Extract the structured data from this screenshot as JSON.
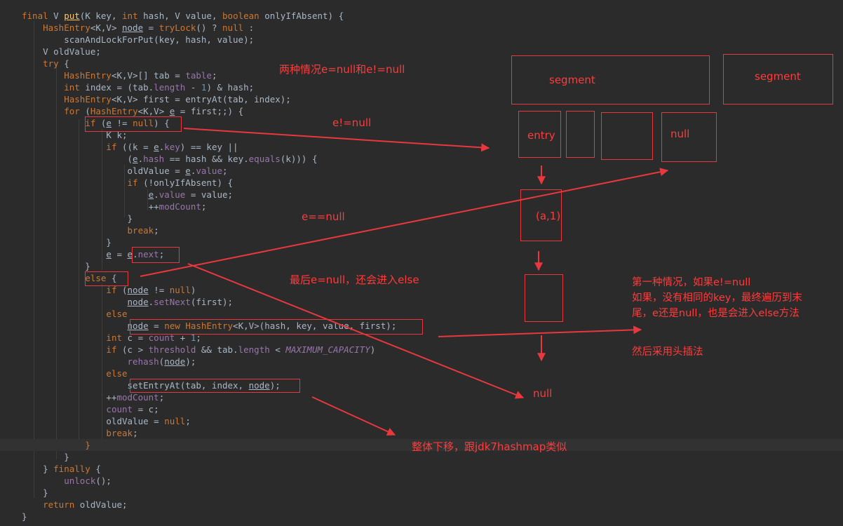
{
  "code": {
    "lines": [
      [
        {
          "t": "final ",
          "c": "kw"
        },
        {
          "t": "V "
        },
        {
          "t": "put",
          "c": "fn u"
        },
        {
          "t": "(K key, "
        },
        {
          "t": "int ",
          "c": "kw"
        },
        {
          "t": "hash, V value, "
        },
        {
          "t": "boolean ",
          "c": "kw"
        },
        {
          "t": "onlyIfAbsent) {"
        }
      ],
      [
        {
          "t": "    "
        },
        {
          "t": "HashEntry",
          "c": "kw"
        },
        {
          "t": "<K,V> "
        },
        {
          "t": "node",
          "c": "u"
        },
        {
          "t": " = "
        },
        {
          "t": "tryLock",
          "c": "kw"
        },
        {
          "t": "() ? "
        },
        {
          "t": "null",
          "c": "kw"
        },
        {
          "t": " :"
        }
      ],
      [
        {
          "t": "        scanAndLockForPut(key, hash, value);"
        }
      ],
      [
        {
          "t": "    V oldValue;"
        }
      ],
      [
        {
          "t": "    "
        },
        {
          "t": "try",
          "c": "kw"
        },
        {
          "t": " {"
        }
      ],
      [
        {
          "t": "        "
        },
        {
          "t": "HashEntry",
          "c": "kw"
        },
        {
          "t": "<K,V>[] tab = "
        },
        {
          "t": "table",
          "c": "fld"
        },
        {
          "t": ";"
        }
      ],
      [
        {
          "t": "        "
        },
        {
          "t": "int ",
          "c": "kw"
        },
        {
          "t": "index = (tab."
        },
        {
          "t": "length",
          "c": "fld"
        },
        {
          "t": " - "
        },
        {
          "t": "1",
          "c": "num"
        },
        {
          "t": ") & hash;"
        }
      ],
      [
        {
          "t": "        "
        },
        {
          "t": "HashEntry",
          "c": "kw"
        },
        {
          "t": "<K,V> first = entryAt(tab, index);"
        }
      ],
      [
        {
          "t": "        "
        },
        {
          "t": "for ",
          "c": "kw"
        },
        {
          "t": "("
        },
        {
          "t": "HashEntry",
          "c": "kw"
        },
        {
          "t": "<K,V> "
        },
        {
          "t": "e",
          "c": "u"
        },
        {
          "t": " = first;;) {"
        }
      ],
      [
        {
          "t": "            "
        },
        {
          "t": "if ",
          "c": "kw"
        },
        {
          "t": "("
        },
        {
          "t": "e",
          "c": "u"
        },
        {
          "t": " != "
        },
        {
          "t": "null",
          "c": "kw"
        },
        {
          "t": ") {"
        }
      ],
      [
        {
          "t": "                K k;"
        }
      ],
      [
        {
          "t": "                "
        },
        {
          "t": "if ",
          "c": "kw"
        },
        {
          "t": "((k = "
        },
        {
          "t": "e",
          "c": "u"
        },
        {
          "t": "."
        },
        {
          "t": "key",
          "c": "fld"
        },
        {
          "t": ") == key ||"
        }
      ],
      [
        {
          "t": "                    ("
        },
        {
          "t": "e",
          "c": "u"
        },
        {
          "t": "."
        },
        {
          "t": "hash",
          "c": "fld"
        },
        {
          "t": " == hash && key."
        },
        {
          "t": "equals",
          "c": "fld"
        },
        {
          "t": "(k))) {"
        }
      ],
      [
        {
          "t": "                    oldValue = "
        },
        {
          "t": "e",
          "c": "u"
        },
        {
          "t": "."
        },
        {
          "t": "value",
          "c": "fld"
        },
        {
          "t": ";"
        }
      ],
      [
        {
          "t": "                    "
        },
        {
          "t": "if ",
          "c": "kw"
        },
        {
          "t": "(!onlyIfAbsent) {"
        }
      ],
      [
        {
          "t": "                        "
        },
        {
          "t": "e",
          "c": "u"
        },
        {
          "t": "."
        },
        {
          "t": "value",
          "c": "fld"
        },
        {
          "t": " = value;"
        }
      ],
      [
        {
          "t": "                        ++"
        },
        {
          "t": "modCount",
          "c": "fld"
        },
        {
          "t": ";"
        }
      ],
      [
        {
          "t": "                    }"
        }
      ],
      [
        {
          "t": "                    "
        },
        {
          "t": "break",
          "c": "kw"
        },
        {
          "t": ";"
        }
      ],
      [
        {
          "t": "                }"
        }
      ],
      [
        {
          "t": "                "
        },
        {
          "t": "e",
          "c": "u"
        },
        {
          "t": " = "
        },
        {
          "t": "e",
          "c": "u"
        },
        {
          "t": "."
        },
        {
          "t": "next",
          "c": "fld"
        },
        {
          "t": ";"
        }
      ],
      [
        {
          "t": "            }"
        }
      ],
      [
        {
          "t": "            "
        },
        {
          "t": "else",
          "c": "kw"
        },
        {
          "t": " {"
        }
      ],
      [
        {
          "t": "                "
        },
        {
          "t": "if ",
          "c": "kw"
        },
        {
          "t": "("
        },
        {
          "t": "node",
          "c": "u"
        },
        {
          "t": " != "
        },
        {
          "t": "null",
          "c": "kw"
        },
        {
          "t": ")"
        }
      ],
      [
        {
          "t": "                    "
        },
        {
          "t": "node",
          "c": "u"
        },
        {
          "t": "."
        },
        {
          "t": "setNext",
          "c": "fld"
        },
        {
          "t": "(first);"
        }
      ],
      [
        {
          "t": "                "
        },
        {
          "t": "else",
          "c": "kw"
        }
      ],
      [
        {
          "t": "                    "
        },
        {
          "t": "node",
          "c": "u"
        },
        {
          "t": " = "
        },
        {
          "t": "new ",
          "c": "kw"
        },
        {
          "t": "HashEntry",
          "c": "kw"
        },
        {
          "t": "<K,V>(hash, key, value, first);"
        }
      ],
      [
        {
          "t": "                "
        },
        {
          "t": "int ",
          "c": "kw"
        },
        {
          "t": "c = "
        },
        {
          "t": "count",
          "c": "fld"
        },
        {
          "t": " + "
        },
        {
          "t": "1",
          "c": "num"
        },
        {
          "t": ";"
        }
      ],
      [
        {
          "t": "                "
        },
        {
          "t": "if ",
          "c": "kw"
        },
        {
          "t": "(c > "
        },
        {
          "t": "threshold",
          "c": "fld"
        },
        {
          "t": " && tab."
        },
        {
          "t": "length",
          "c": "fld"
        },
        {
          "t": " < "
        },
        {
          "t": "MAXIMUM_CAPACITY",
          "c": "const"
        },
        {
          "t": ")"
        }
      ],
      [
        {
          "t": "                    "
        },
        {
          "t": "rehash",
          "c": "fld"
        },
        {
          "t": "("
        },
        {
          "t": "node",
          "c": "u"
        },
        {
          "t": ");"
        }
      ],
      [
        {
          "t": "                "
        },
        {
          "t": "else",
          "c": "kw"
        }
      ],
      [
        {
          "t": "                    setEntryAt(tab, index, "
        },
        {
          "t": "node",
          "c": "u"
        },
        {
          "t": ");"
        }
      ],
      [
        {
          "t": "                ++"
        },
        {
          "t": "modCount",
          "c": "fld"
        },
        {
          "t": ";"
        }
      ],
      [
        {
          "t": "                "
        },
        {
          "t": "count",
          "c": "fld"
        },
        {
          "t": " = c;"
        }
      ],
      [
        {
          "t": "                oldValue = "
        },
        {
          "t": "null",
          "c": "kw"
        },
        {
          "t": ";"
        }
      ],
      [
        {
          "t": "                "
        },
        {
          "t": "break",
          "c": "kw"
        },
        {
          "t": ";"
        }
      ],
      [
        {
          "t": "            "
        },
        {
          "t": "}",
          "c": "kw"
        }
      ],
      [
        {
          "t": "        }"
        }
      ],
      [
        {
          "t": "    } "
        },
        {
          "t": "finally",
          "c": "kw"
        },
        {
          "t": " {"
        }
      ],
      [
        {
          "t": "        "
        },
        {
          "t": "unlock",
          "c": "fld"
        },
        {
          "t": "();"
        }
      ],
      [
        {
          "t": "    }"
        }
      ],
      [
        {
          "t": "    "
        },
        {
          "t": "return ",
          "c": "kw"
        },
        {
          "t": "oldValue;"
        }
      ],
      [
        {
          "t": "}"
        }
      ]
    ],
    "highlight_line": 36
  },
  "annotations": {
    "label_two_cases": "两种情况e=null和e!=null",
    "label_e_not_null": "e!=null",
    "label_e_eq_null": "e==null",
    "label_last_else": "最后e=null，还会进入else",
    "note_case1_line1": "第一种情况，如果e!=null",
    "note_case1_line2": "如果，没有相同的key，最终遍历到末",
    "note_case1_line3": "尾，e还是null，也是会进入else方法",
    "note_head_insert": "然后采用头插法",
    "note_shift_down": "整体下移，跟jdk7hashmap类似"
  },
  "diagram": {
    "segment1": "segment",
    "segment2": "segment",
    "entry": "entry",
    "null_slot": "null",
    "pair": "(a,1)",
    "null_end": "null"
  },
  "colors": {
    "background": "#2b2b2b",
    "annotation_red": "#e8383d",
    "keyword": "#cc7832",
    "field": "#9876aa",
    "text": "#a9b7c6"
  }
}
